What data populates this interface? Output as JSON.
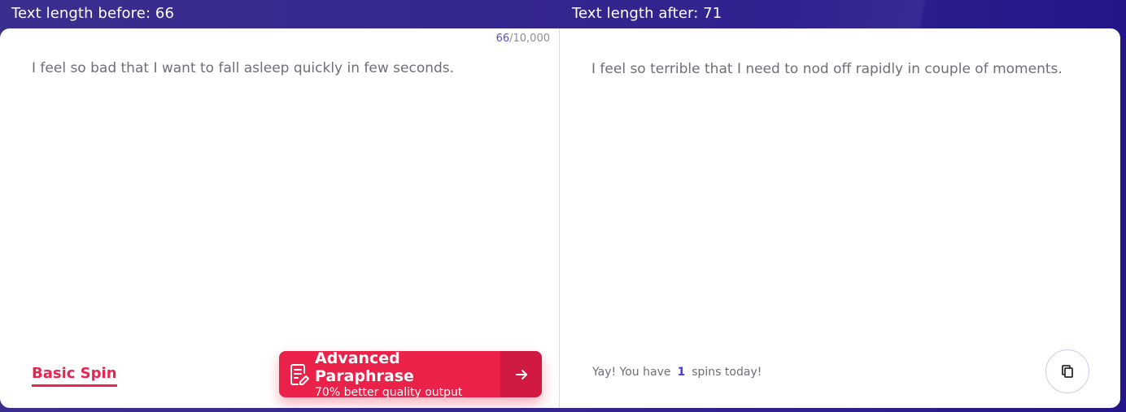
{
  "header": {
    "before_label": "Text length before: 66",
    "after_label": "Text length after: 71"
  },
  "input": {
    "counter_current": "66",
    "counter_max": "/10,000",
    "text": "I feel so bad that I want to fall asleep quickly in few seconds."
  },
  "output": {
    "text": "I feel so terrible that I need to nod off rapidly in couple of moments."
  },
  "controls": {
    "basic_spin_label": "Basic Spin",
    "advanced_title": "Advanced Paraphrase",
    "advanced_subtitle": "70% better quality output"
  },
  "spins": {
    "prefix": "Yay! You have",
    "count": "1",
    "suffix": "spins today!"
  },
  "icons": {
    "document": "document-edit-icon",
    "arrow": "arrow-right-icon",
    "copy": "copy-icon"
  },
  "colors": {
    "accent": "#ea2249",
    "brand": "#35288d",
    "highlight": "#4a3fd0"
  }
}
